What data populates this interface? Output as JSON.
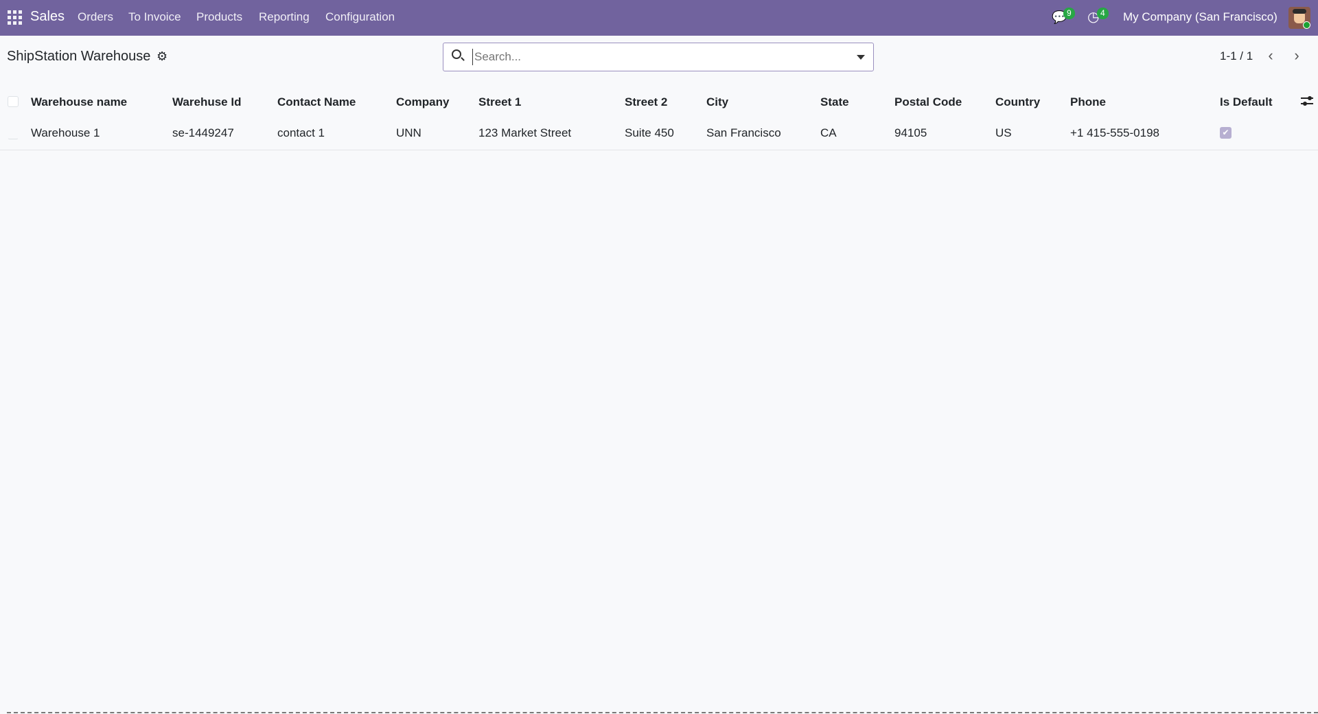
{
  "navbar": {
    "app": "Sales",
    "menu": [
      "Orders",
      "To Invoice",
      "Products",
      "Reporting",
      "Configuration"
    ],
    "messages_count": "9",
    "activities_count": "4",
    "company": "My Company (San Francisco)"
  },
  "page": {
    "title": "ShipStation Warehouse",
    "search_placeholder": "Search...",
    "pager": "1-1 / 1"
  },
  "table": {
    "columns": [
      "Warehouse name",
      "Warehuse Id",
      "Contact Name",
      "Company",
      "Street 1",
      "Street 2",
      "City",
      "State",
      "Postal Code",
      "Country",
      "Phone",
      "Is Default"
    ],
    "rows": [
      [
        "Warehouse 1",
        "se-1449247",
        "contact 1",
        "UNN",
        "123 Market Street",
        "Suite 450",
        "San Francisco",
        "CA",
        "94105",
        "US",
        "+1 415-555-0198",
        true
      ]
    ]
  },
  "colors": {
    "navbar": "#71639e",
    "badge": "#28a745"
  }
}
